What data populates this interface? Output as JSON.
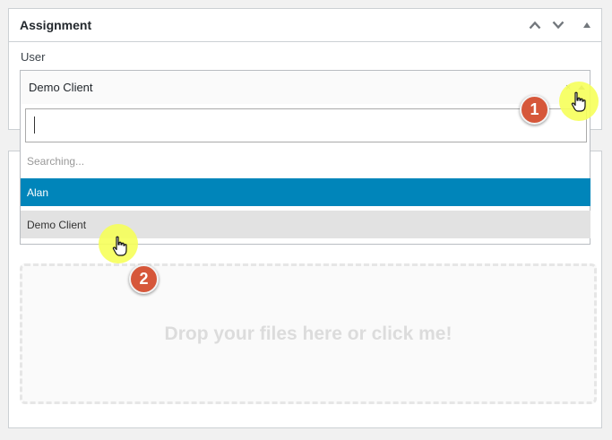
{
  "assignment": {
    "title": "Assignment",
    "user_label": "User",
    "selected_value": "Demo Client",
    "clear_symbol": "×"
  },
  "dropdown": {
    "search_value": "",
    "status_text": "Searching...",
    "options": [
      {
        "label": "Alan",
        "highlighted": true
      },
      {
        "label": "Demo Client",
        "highlighted": false
      }
    ]
  },
  "upload": {
    "dropzone_text": "Drop your files here or click me!"
  },
  "annotations": {
    "step_1": "1",
    "step_2": "2"
  },
  "colors": {
    "highlight_option": "#0085ba",
    "badge": "#d6573a",
    "cursor_highlight": "#f6ff5a"
  },
  "icons": {
    "move_up": "chevron-up-icon",
    "move_down": "chevron-down-icon",
    "toggle": "triangle-up-icon",
    "cursor": "hand-pointer-icon"
  }
}
